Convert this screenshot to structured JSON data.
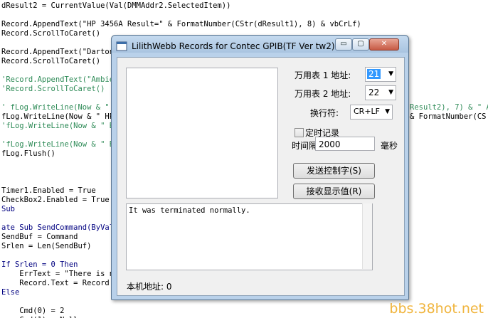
{
  "code_lines": [
    {
      "text": "dResult2 = CurrentValue(Val(DMMAddr2.SelectedItem))",
      "style": ""
    },
    {
      "text": "",
      "style": ""
    },
    {
      "text": "Record.AppendText(\"HP 3456A Result=\" & FormatNumber(CStr(dResult1), 8) & vbCrLf)",
      "style": ""
    },
    {
      "text": "Record.ScrollToCaret()",
      "style": ""
    },
    {
      "text": "",
      "style": ""
    },
    {
      "text": "Record.AppendText(\"Darton",
      "style": ""
    },
    {
      "text": "Record.ScrollToCaret()",
      "style": ""
    },
    {
      "text": "",
      "style": ""
    },
    {
      "text": "'Record.AppendText(\"Ambien",
      "style": "cm"
    },
    {
      "text": "'Record.ScrollToCaret()",
      "style": "cm"
    },
    {
      "text": "",
      "style": ""
    },
    {
      "text": "' fLog.WriteLine(Now & \" B",
      "style": "cm"
    },
    {
      "text": "fLog.WriteLine(Now & \" HP3",
      "style": ""
    },
    {
      "text": "'fLog.WriteLine(Now & \" Bt",
      "style": "cm"
    },
    {
      "text": "",
      "style": ""
    },
    {
      "text": "'fLog.WriteLine(Now & \" Bt",
      "style": "cm"
    },
    {
      "text": "fLog.Flush()",
      "style": ""
    },
    {
      "text": "",
      "style": ""
    },
    {
      "text": "",
      "style": ""
    },
    {
      "text": "",
      "style": ""
    },
    {
      "text": "Timer1.Enabled = True",
      "style": ""
    },
    {
      "text": "CheckBox2.Enabled = True",
      "style": ""
    },
    {
      "text": "Sub",
      "style": "kw"
    },
    {
      "text": "",
      "style": ""
    },
    {
      "text": "ate Sub SendCommand(ByVal",
      "style": "kw"
    },
    {
      "text": "SendBuf = Command",
      "style": ""
    },
    {
      "text": "Srlen = Len(SendBuf)",
      "style": ""
    },
    {
      "text": "",
      "style": ""
    },
    {
      "text": "If Srlen = 0 Then",
      "style": "kw"
    },
    {
      "text": "    ErrText = \"There is no",
      "style": ""
    },
    {
      "text": "    Record.Text = Record.T",
      "style": ""
    },
    {
      "text": "Else",
      "style": "kw"
    },
    {
      "text": "",
      "style": ""
    },
    {
      "text": "    Cmd(0) = 2",
      "style": ""
    },
    {
      "text": "    Cmd(1) = Null",
      "style": ""
    }
  ],
  "code_right_fragments": [
    {
      "text": "Result2), 7) & \" A",
      "line": 11,
      "style": "cm"
    },
    {
      "text": "& FormatNumber(CS",
      "line": 12,
      "style": ""
    }
  ],
  "watermark": "bbs.38hot.net",
  "window": {
    "title": "LilithWebb Records for Contec GPIB(TF Ver tw2)",
    "minimize_label": "▭",
    "maximize_label": "▢",
    "close_label": "✕",
    "dmm1_label": "万用表 1 地址:",
    "dmm1_value": "21",
    "dmm2_label": "万用表 2 地址:",
    "dmm2_value": "22",
    "newline_label": "换行符:",
    "newline_value": "CR+LF",
    "timed_record_label": "定时记录",
    "timed_record_checked": false,
    "interval_label": "时间隔:",
    "interval_value": "2000",
    "interval_unit": "毫秒",
    "send_button": "发送控制字(S)",
    "receive_button": "接收显示值(R)",
    "status_text": "It was terminated normally.",
    "host_address_label": "本机地址: 0"
  }
}
